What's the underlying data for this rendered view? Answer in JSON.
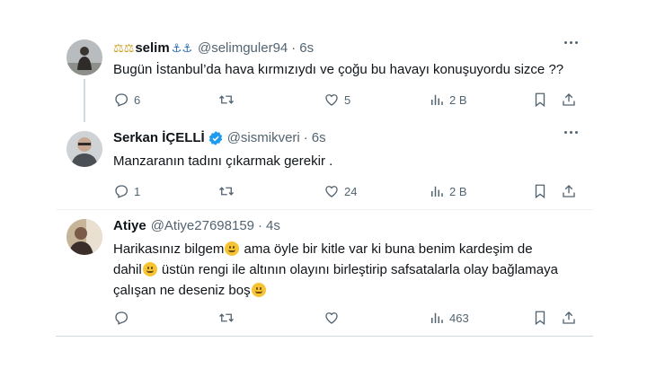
{
  "tweets": [
    {
      "emoji_prefix": "⚖⚖",
      "name": "selim",
      "name_suffix": "⚓⚓",
      "handle": "@selimguler94",
      "dot": "·",
      "time": "6s",
      "lines": [
        "Bugün İstanbul’da hava kırmızıydı ve çoğu bu havayı konuşuyordu sizce ??"
      ],
      "actions": {
        "reply": "6",
        "repost": "",
        "like": "5",
        "views": "2 B"
      }
    },
    {
      "name": "Serkan İÇELLİ",
      "verified": true,
      "handle": "@sismikveri",
      "dot": "·",
      "time": "6s",
      "lines": [
        "Manzaranın tadını çıkarmak gerekir ."
      ],
      "actions": {
        "reply": "1",
        "repost": "",
        "like": "24",
        "views": "2 B"
      }
    },
    {
      "name": "Atiye",
      "handle": "@Atiye27698159",
      "dot": "·",
      "time": "4s",
      "line1a": "Harikasınız bilgem",
      "line1b": " ama öyle bir kitle var ki buna benim kardeşim de",
      "line2a": "dahil",
      "line2b": " üstün rengi ile altının olayını birleştirip safsatalarla olay bağlamaya",
      "line3a": "çalışan  ne deseniz boş",
      "actions": {
        "reply": "",
        "repost": "",
        "like": "",
        "views": "463"
      }
    }
  ],
  "colors": {
    "text": "#0f1419",
    "muted": "#536471",
    "verified": "#1d9bf0",
    "border": "#eff3f4"
  },
  "icons": [
    "more-icon",
    "reply-icon",
    "repost-icon",
    "like-icon",
    "views-icon",
    "bookmark-icon",
    "share-icon",
    "verified-badge-icon",
    "smiley-emoji"
  ]
}
